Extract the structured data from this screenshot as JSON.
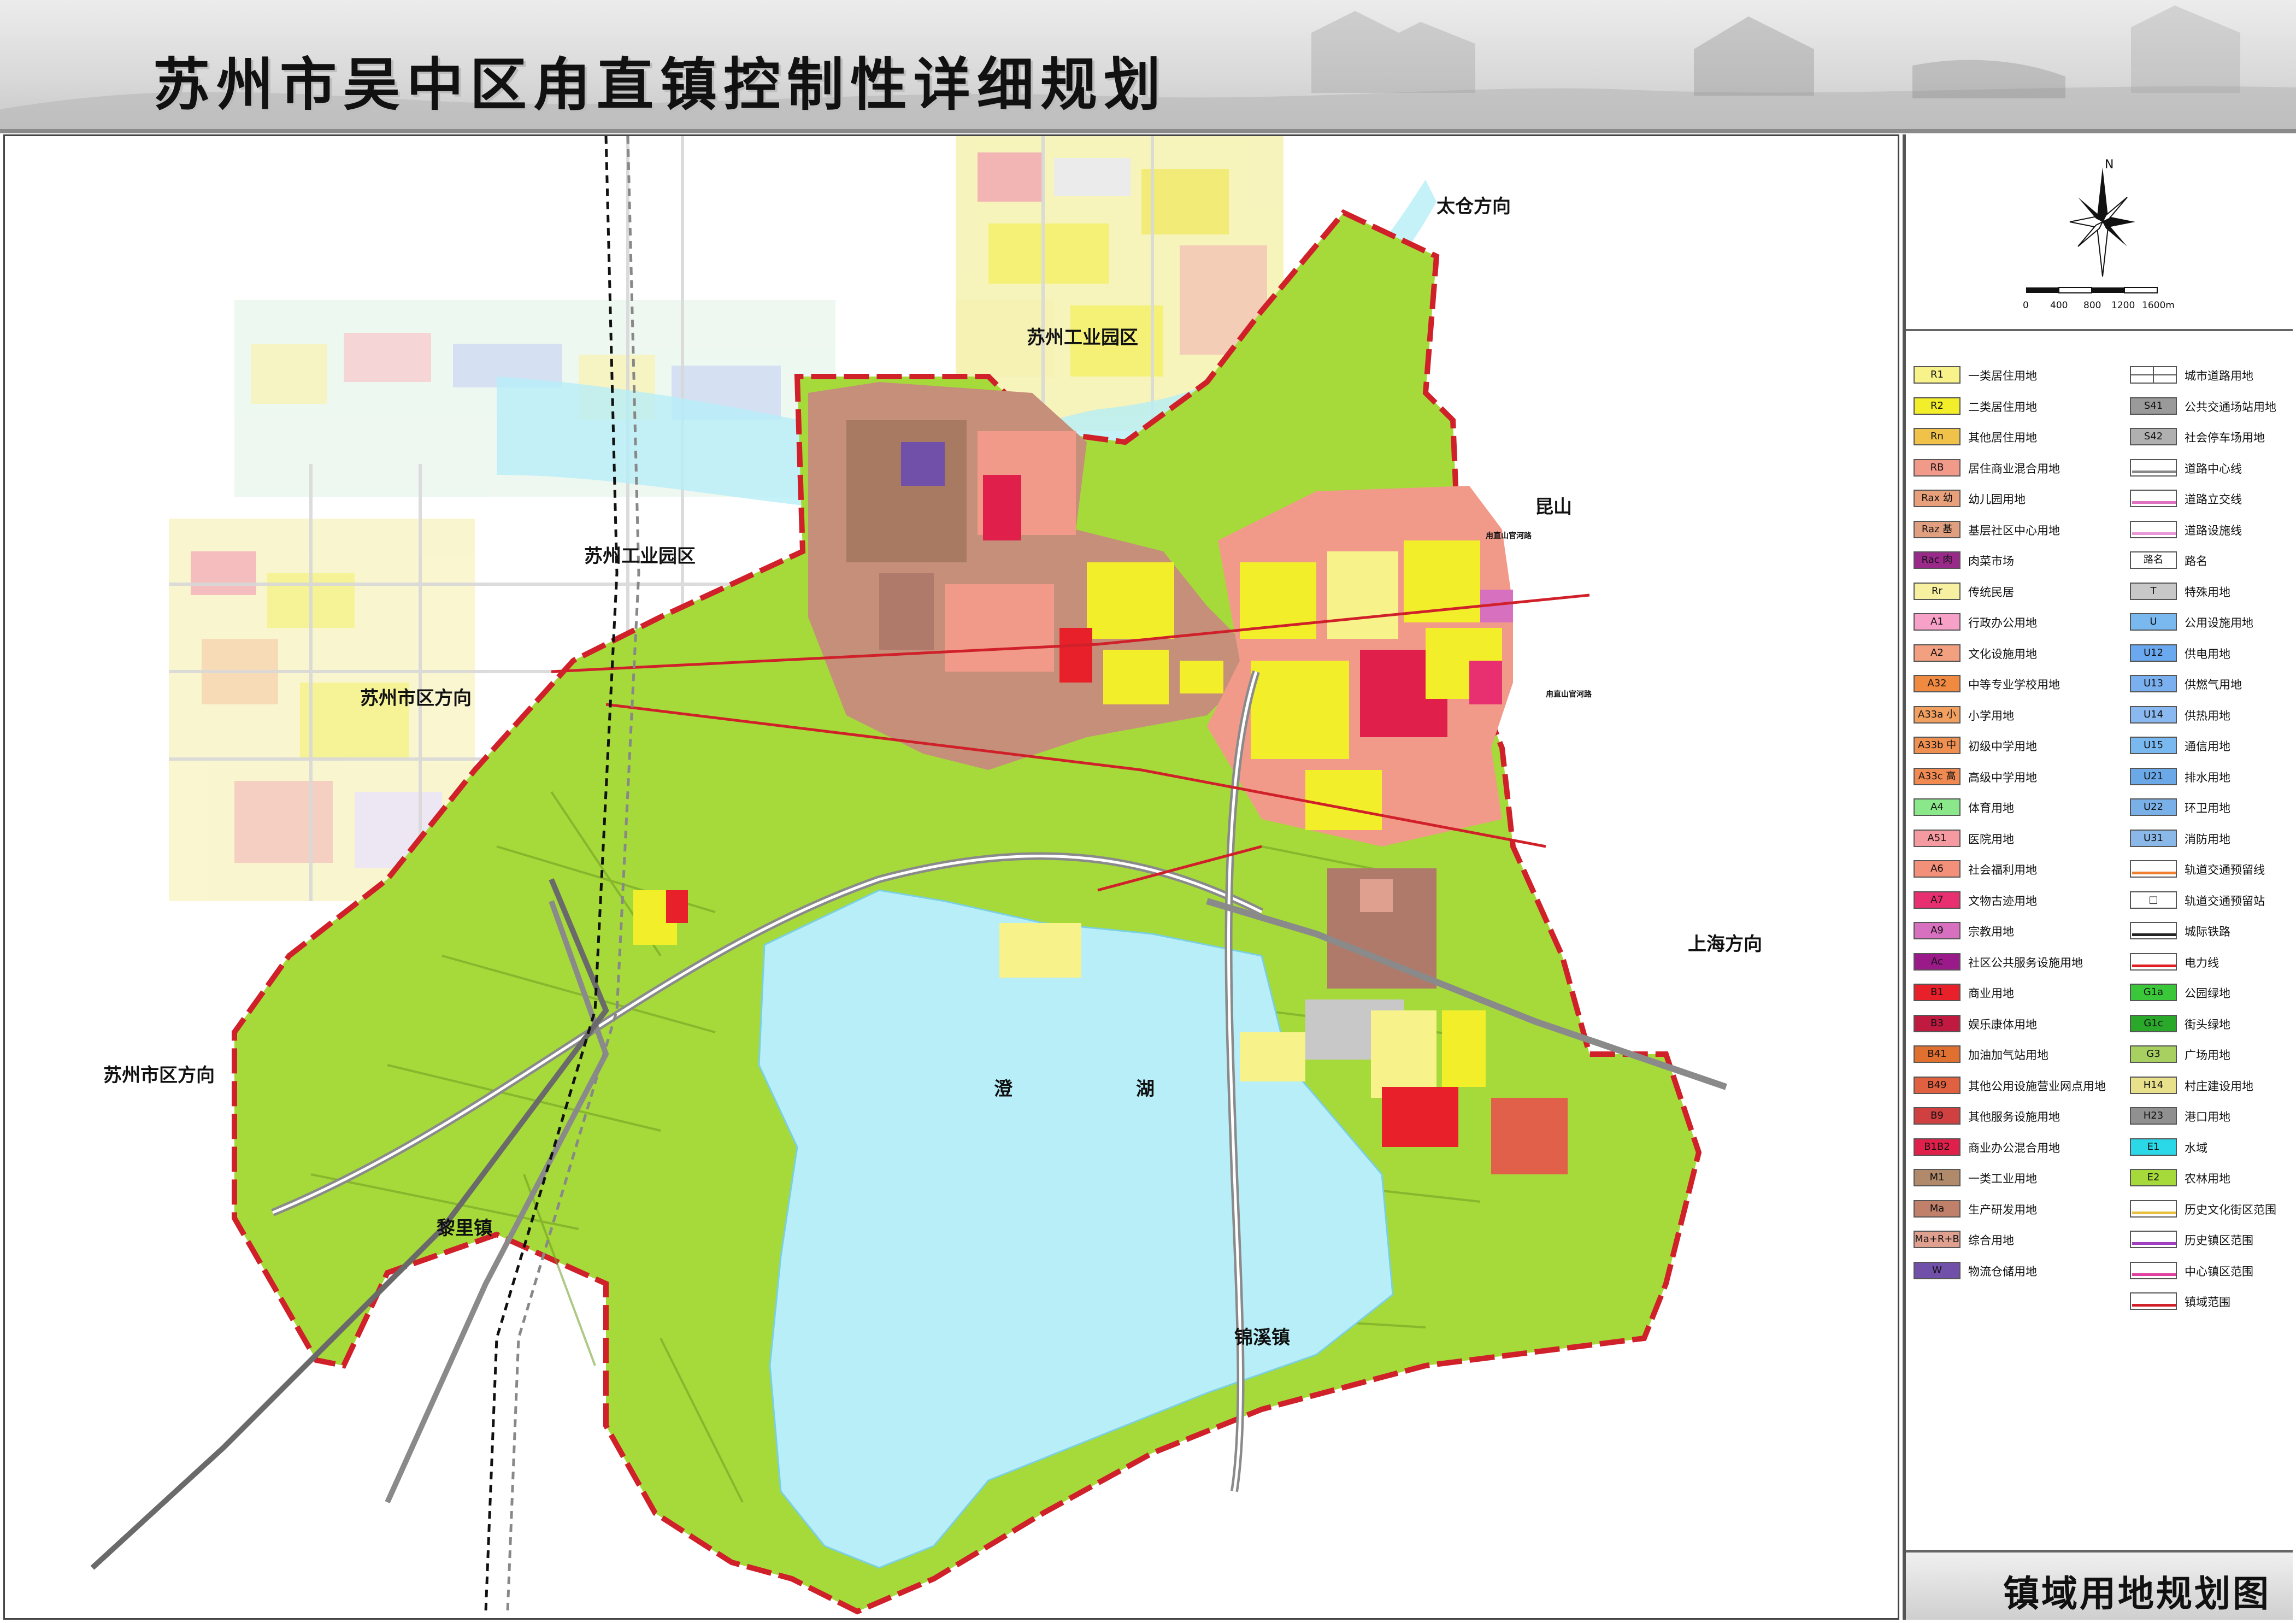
{
  "header": {
    "title": "苏州市吴中区甪直镇控制性详细规划"
  },
  "drawing_title": "镇域用地规划图",
  "compass": {
    "north_label": "N",
    "scale_labels": [
      "0",
      "400",
      "800",
      "1200",
      "1600m"
    ]
  },
  "colors": {
    "boundary": "#d0202a",
    "lake": "#b7eef8",
    "farmland": "#a6d93a",
    "residential": "#f2ee2a"
  },
  "map_labels": {
    "taicang": "太仓方向",
    "sip_north": "苏州工业园区",
    "kunshan": "昆山",
    "sip_west": "苏州工业园区",
    "suzhou_east": "苏州市区方向",
    "shanghai": "上海方向",
    "suzhou_west": "苏州市区方向",
    "lake_1": "澄",
    "lake_2": "湖",
    "lili": "黎里镇",
    "jinxi": "锦溪镇",
    "road_1": "甪直山官河路",
    "road_2": "甪直山官河路"
  },
  "legend": {
    "left": [
      {
        "code": "R1",
        "label": "一类居住用地",
        "color": "#f7f28a"
      },
      {
        "code": "R2",
        "label": "二类居住用地",
        "color": "#f2ee2a"
      },
      {
        "code": "Rn",
        "label": "其他居住用地",
        "color": "#f0c24a"
      },
      {
        "code": "RB",
        "label": "居住商业混合用地",
        "color": "#f29a8a"
      },
      {
        "code": "Rax 幼",
        "label": "幼儿园用地",
        "color": "#e8a07a"
      },
      {
        "code": "Raz 基",
        "label": "基层社区中心用地",
        "color": "#e0a080"
      },
      {
        "code": "Rac 肉",
        "label": "肉菜市场",
        "color": "#9a2a8a"
      },
      {
        "code": "Rr",
        "label": "传统民居",
        "color": "#f7f0a0"
      },
      {
        "code": "A1",
        "label": "行政办公用地",
        "color": "#f7a0c8"
      },
      {
        "code": "A2",
        "label": "文化设施用地",
        "color": "#f2a080"
      },
      {
        "code": "A32",
        "label": "中等专业学校用地",
        "color": "#f08a40"
      },
      {
        "code": "A33a 小",
        "label": "小学用地",
        "color": "#f2a060"
      },
      {
        "code": "A33b 中",
        "label": "初级中学用地",
        "color": "#f09050"
      },
      {
        "code": "A33c 高",
        "label": "高级中学用地",
        "color": "#f08a50"
      },
      {
        "code": "A4",
        "label": "体育用地",
        "color": "#8ae88a"
      },
      {
        "code": "A51",
        "label": "医院用地",
        "color": "#f59aa0"
      },
      {
        "code": "A6",
        "label": "社会福利用地",
        "color": "#f2907a"
      },
      {
        "code": "A7",
        "label": "文物古迹用地",
        "color": "#e83070"
      },
      {
        "code": "A9",
        "label": "宗教用地",
        "color": "#d870c0"
      },
      {
        "code": "Ac",
        "label": "社区公共服务设施用地",
        "color": "#9a1a8a"
      },
      {
        "code": "B1",
        "label": "商业用地",
        "color": "#e8202a"
      },
      {
        "code": "B3",
        "label": "娱乐康体用地",
        "color": "#c01a40"
      },
      {
        "code": "B41",
        "label": "加油加气站用地",
        "color": "#e07030"
      },
      {
        "code": "B49",
        "label": "其他公用设施营业网点用地",
        "color": "#e06040"
      },
      {
        "code": "B9",
        "label": "其他服务设施用地",
        "color": "#d04040"
      },
      {
        "code": "B1B2",
        "label": "商业办公混合用地",
        "color": "#e0204a"
      },
      {
        "code": "M1",
        "label": "一类工业用地",
        "color": "#b08a6a"
      },
      {
        "code": "Ma",
        "label": "生产研发用地",
        "color": "#c0806a"
      },
      {
        "code": "Ma+R+B",
        "label": "综合用地",
        "color": "#e0a090"
      },
      {
        "code": "W",
        "label": "物流仓储用地",
        "color": "#7050a8"
      }
    ],
    "right": [
      {
        "code": "",
        "label": "城市道路用地",
        "kind": "road"
      },
      {
        "code": "S41",
        "label": "公共交通场站用地",
        "color": "#9a9a9a"
      },
      {
        "code": "S42",
        "label": "社会停车场用地",
        "color": "#b0b0b0"
      },
      {
        "code": "",
        "label": "道路中心线",
        "kind": "line",
        "line": "#888888"
      },
      {
        "code": "",
        "label": "道路立交线",
        "kind": "line",
        "line": "#e070c0"
      },
      {
        "code": "",
        "label": "道路设施线",
        "kind": "line",
        "line": "#e898d8"
      },
      {
        "code": "路名",
        "label": "路名",
        "color": "#ffffff"
      },
      {
        "code": "T",
        "label": "特殊用地",
        "color": "#c8c8c8"
      },
      {
        "code": "U",
        "label": "公用设施用地",
        "color": "#7ab8f0"
      },
      {
        "code": "U12",
        "label": "供电用地",
        "color": "#6aa8f0"
      },
      {
        "code": "U13",
        "label": "供燃气用地",
        "color": "#7ab0f0"
      },
      {
        "code": "U14",
        "label": "供热用地",
        "color": "#8ab8f0"
      },
      {
        "code": "U15",
        "label": "通信用地",
        "color": "#7ab8f0"
      },
      {
        "code": "U21",
        "label": "排水用地",
        "color": "#6aa8e8"
      },
      {
        "code": "U22",
        "label": "环卫用地",
        "color": "#7ab0e8"
      },
      {
        "code": "U31",
        "label": "消防用地",
        "color": "#8ab8e8"
      },
      {
        "code": "",
        "label": "轨道交通预留线",
        "kind": "line",
        "line": "#f08030"
      },
      {
        "code": "□",
        "label": "轨道交通预留站",
        "color": "#ffffff"
      },
      {
        "code": "",
        "label": "城际铁路",
        "kind": "line",
        "line": "#222222"
      },
      {
        "code": "",
        "label": "电力线",
        "kind": "line",
        "line": "#e02020"
      },
      {
        "code": "G1a",
        "label": "公园绿地",
        "color": "#3ac83a"
      },
      {
        "code": "G1c",
        "label": "街头绿地",
        "color": "#2aa82a"
      },
      {
        "code": "G3",
        "label": "广场用地",
        "color": "#a8d060"
      },
      {
        "code": "H14",
        "label": "村庄建设用地",
        "color": "#e8e08a"
      },
      {
        "code": "H23",
        "label": "港口用地",
        "color": "#909090"
      },
      {
        "code": "E1",
        "label": "水域",
        "color": "#2ad8e8"
      },
      {
        "code": "E2",
        "label": "农林用地",
        "color": "#a6d93a"
      },
      {
        "code": "",
        "label": "历史文化街区范围",
        "kind": "line",
        "line": "#e8c040"
      },
      {
        "code": "",
        "label": "历史镇区范围",
        "kind": "line",
        "line": "#a040c0"
      },
      {
        "code": "",
        "label": "中心镇区范围",
        "kind": "line",
        "line": "#e040a0"
      },
      {
        "code": "",
        "label": "镇域范围",
        "kind": "line",
        "line": "#d0202a"
      }
    ]
  }
}
